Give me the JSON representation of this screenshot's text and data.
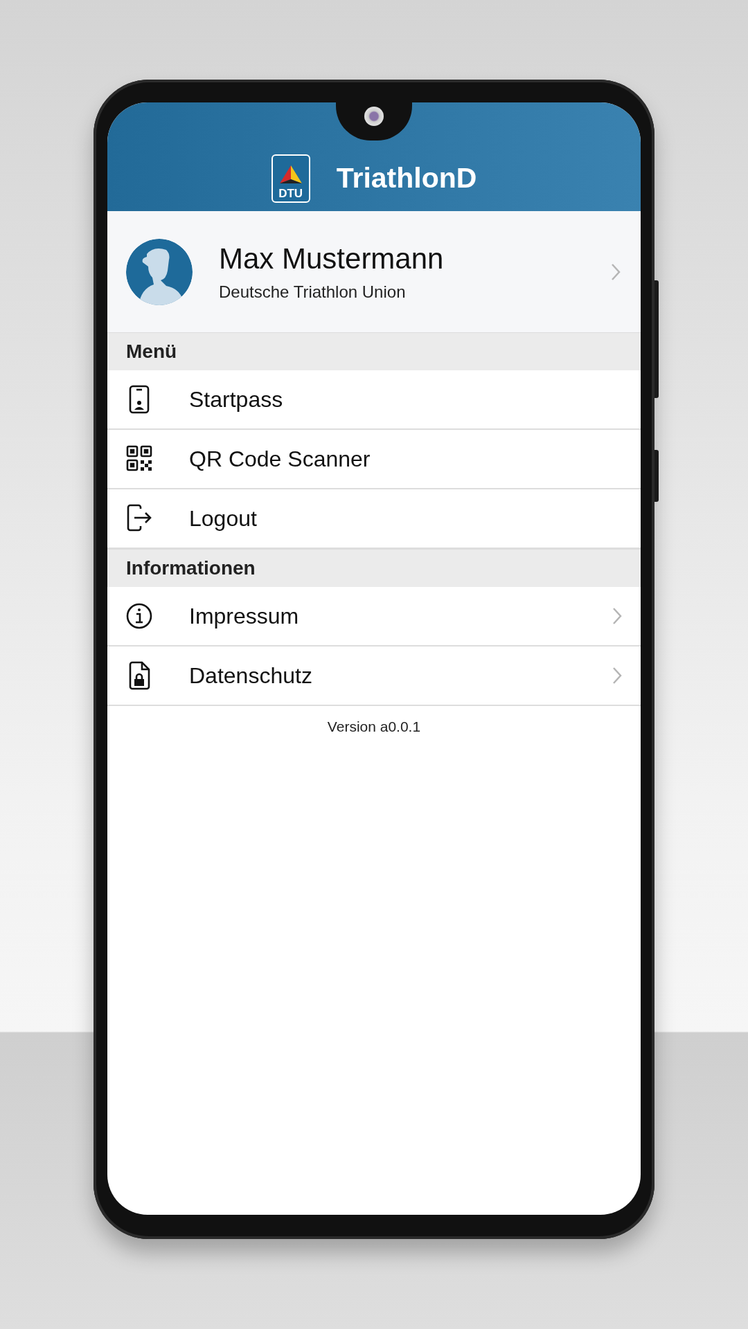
{
  "header": {
    "logo_text": "DTU",
    "title": "TriathlonD"
  },
  "profile": {
    "name": "Max Mustermann",
    "organization": "Deutsche Triathlon Union",
    "has_chevron": true
  },
  "sections": [
    {
      "title": "Menü",
      "items": [
        {
          "kind": "startpass",
          "label": "Startpass",
          "has_chevron": false
        },
        {
          "kind": "scanner",
          "label": "QR Code Scanner",
          "has_chevron": false
        },
        {
          "kind": "logout",
          "label": "Logout",
          "has_chevron": false
        }
      ]
    },
    {
      "title": "Informationen",
      "items": [
        {
          "kind": "imprint",
          "label": "Impressum",
          "has_chevron": true
        },
        {
          "kind": "privacy",
          "label": "Datenschutz",
          "has_chevron": true
        }
      ]
    }
  ],
  "version": "Version a0.0.1"
}
